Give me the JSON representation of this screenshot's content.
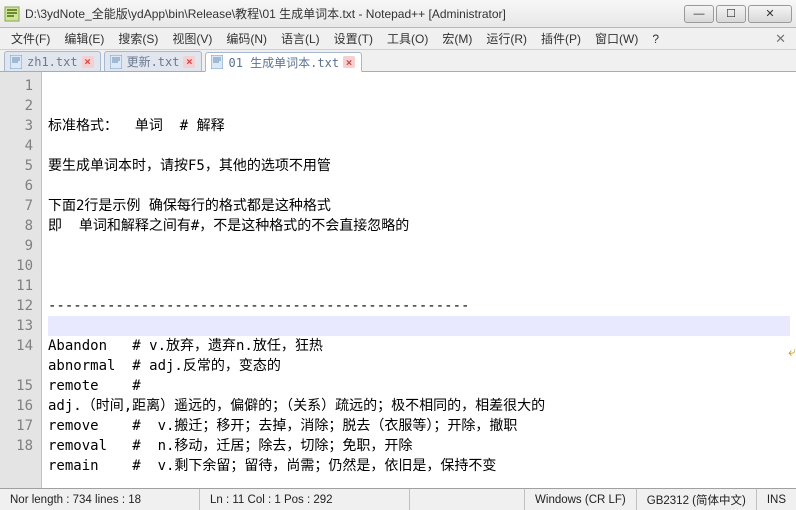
{
  "window": {
    "title": "D:\\3ydNote_全能版\\ydApp\\bin\\Release\\教程\\01 生成单词本.txt - Notepad++ [Administrator]"
  },
  "win_buttons": {
    "min": "—",
    "max": "☐",
    "close": "✕"
  },
  "menus": [
    "文件(F)",
    "编辑(E)",
    "搜索(S)",
    "视图(V)",
    "编码(N)",
    "语言(L)",
    "设置(T)",
    "工具(O)",
    "宏(M)",
    "运行(R)",
    "插件(P)",
    "窗口(W)",
    "?"
  ],
  "tabs": [
    {
      "label": "zh1.txt",
      "active": false
    },
    {
      "label": "更新.txt",
      "active": false
    },
    {
      "label": "01 生成单词本.txt",
      "active": true
    }
  ],
  "gutter": [
    "1",
    "2",
    "3",
    "4",
    "5",
    "6",
    "7",
    "8",
    "9",
    "10",
    "11",
    "12",
    "13",
    "14",
    "",
    "15",
    "16",
    "17",
    "18"
  ],
  "code_lines": [
    "标准格式：  单词  # 解释",
    "",
    "要生成单词本时，请按F5，其他的选项不用管",
    "",
    "下面2行是示例 确保每行的格式都是这种格式",
    "即  单词和解释之间有#，不是这种格式的不会直接忽略的",
    "",
    "",
    "",
    "--------------------------------------------------",
    " ",
    "Abandon   # v.放弃，遗弃n.放任，狂热",
    "abnormal  # adj.反常的，变态的",
    "remote    #",
    "adj.（时间,距离）遥远的，偏僻的；（关系）疏远的；极不相同的，相差很大的",
    "remove    #  v.搬迁；移开；去掉，消除；脱去（衣服等）；开除，撤职",
    "removal   #  n.移动，迁居；除去，切除；免职，开除",
    "remain    #  v.剩下余留；留待，尚需；仍然是，依旧是，保持不变",
    ""
  ],
  "current_line_index": 10,
  "status": {
    "left": "Nor  length : 734     lines : 18",
    "position": "Ln : 11   Col : 1   Pos : 292",
    "eol": "Windows (CR LF)",
    "encoding": "GB2312 (简体中文)",
    "mode": "INS"
  }
}
